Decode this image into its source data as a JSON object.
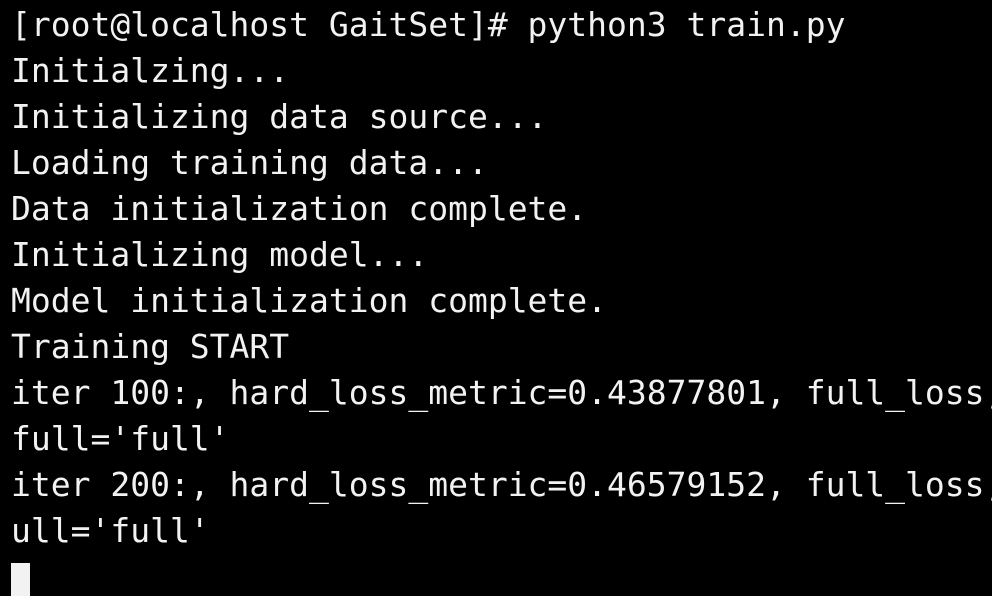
{
  "terminal": {
    "lines": [
      "[root@localhost GaitSet]# python3 train.py",
      "Initialzing...",
      "Initializing data source...",
      "Loading training data...",
      "Data initialization complete.",
      "Initializing model...",
      "Model initialization complete.",
      "Training START",
      "iter 100:, hard_loss_metric=0.43877801, full_loss,",
      "full='full'",
      "iter 200:, hard_loss_metric=0.46579152, full_loss,",
      "ull='full'"
    ]
  },
  "colors": {
    "background": "#000000",
    "foreground": "#f2f2f2"
  }
}
